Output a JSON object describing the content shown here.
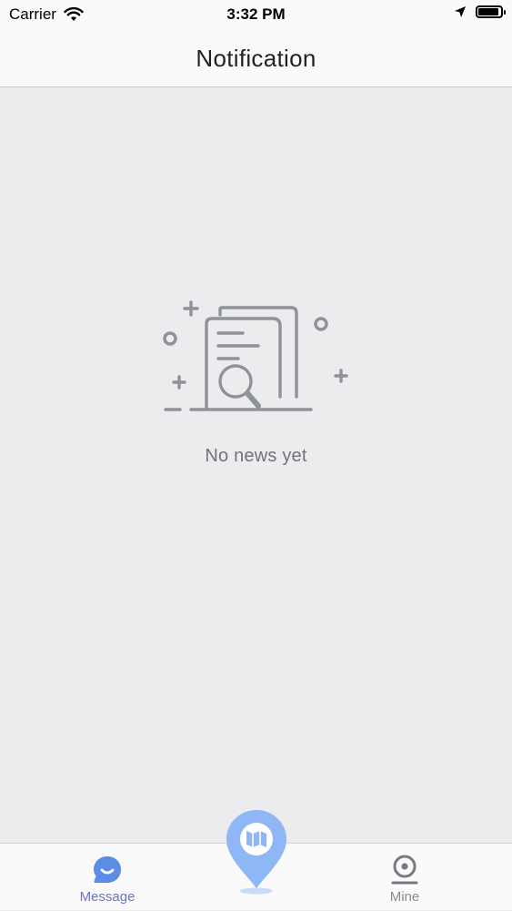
{
  "status_bar": {
    "carrier": "Carrier",
    "time": "3:32 PM"
  },
  "nav": {
    "title": "Notification"
  },
  "empty_state": {
    "text": "No news yet",
    "icon": "document-search-icon"
  },
  "tab_bar": {
    "tabs": [
      {
        "label": "Message",
        "icon": "chat-bubble-icon",
        "active": true
      },
      {
        "label": "",
        "icon": "map-pin-icon",
        "active": false
      },
      {
        "label": "Mine",
        "icon": "user-profile-icon",
        "active": false
      }
    ]
  },
  "colors": {
    "accent": "#6a73c9",
    "center_button": "#8fb6f5",
    "message_icon": "#5b8de8",
    "background": "#ececee",
    "illustration": "#8e9299"
  }
}
